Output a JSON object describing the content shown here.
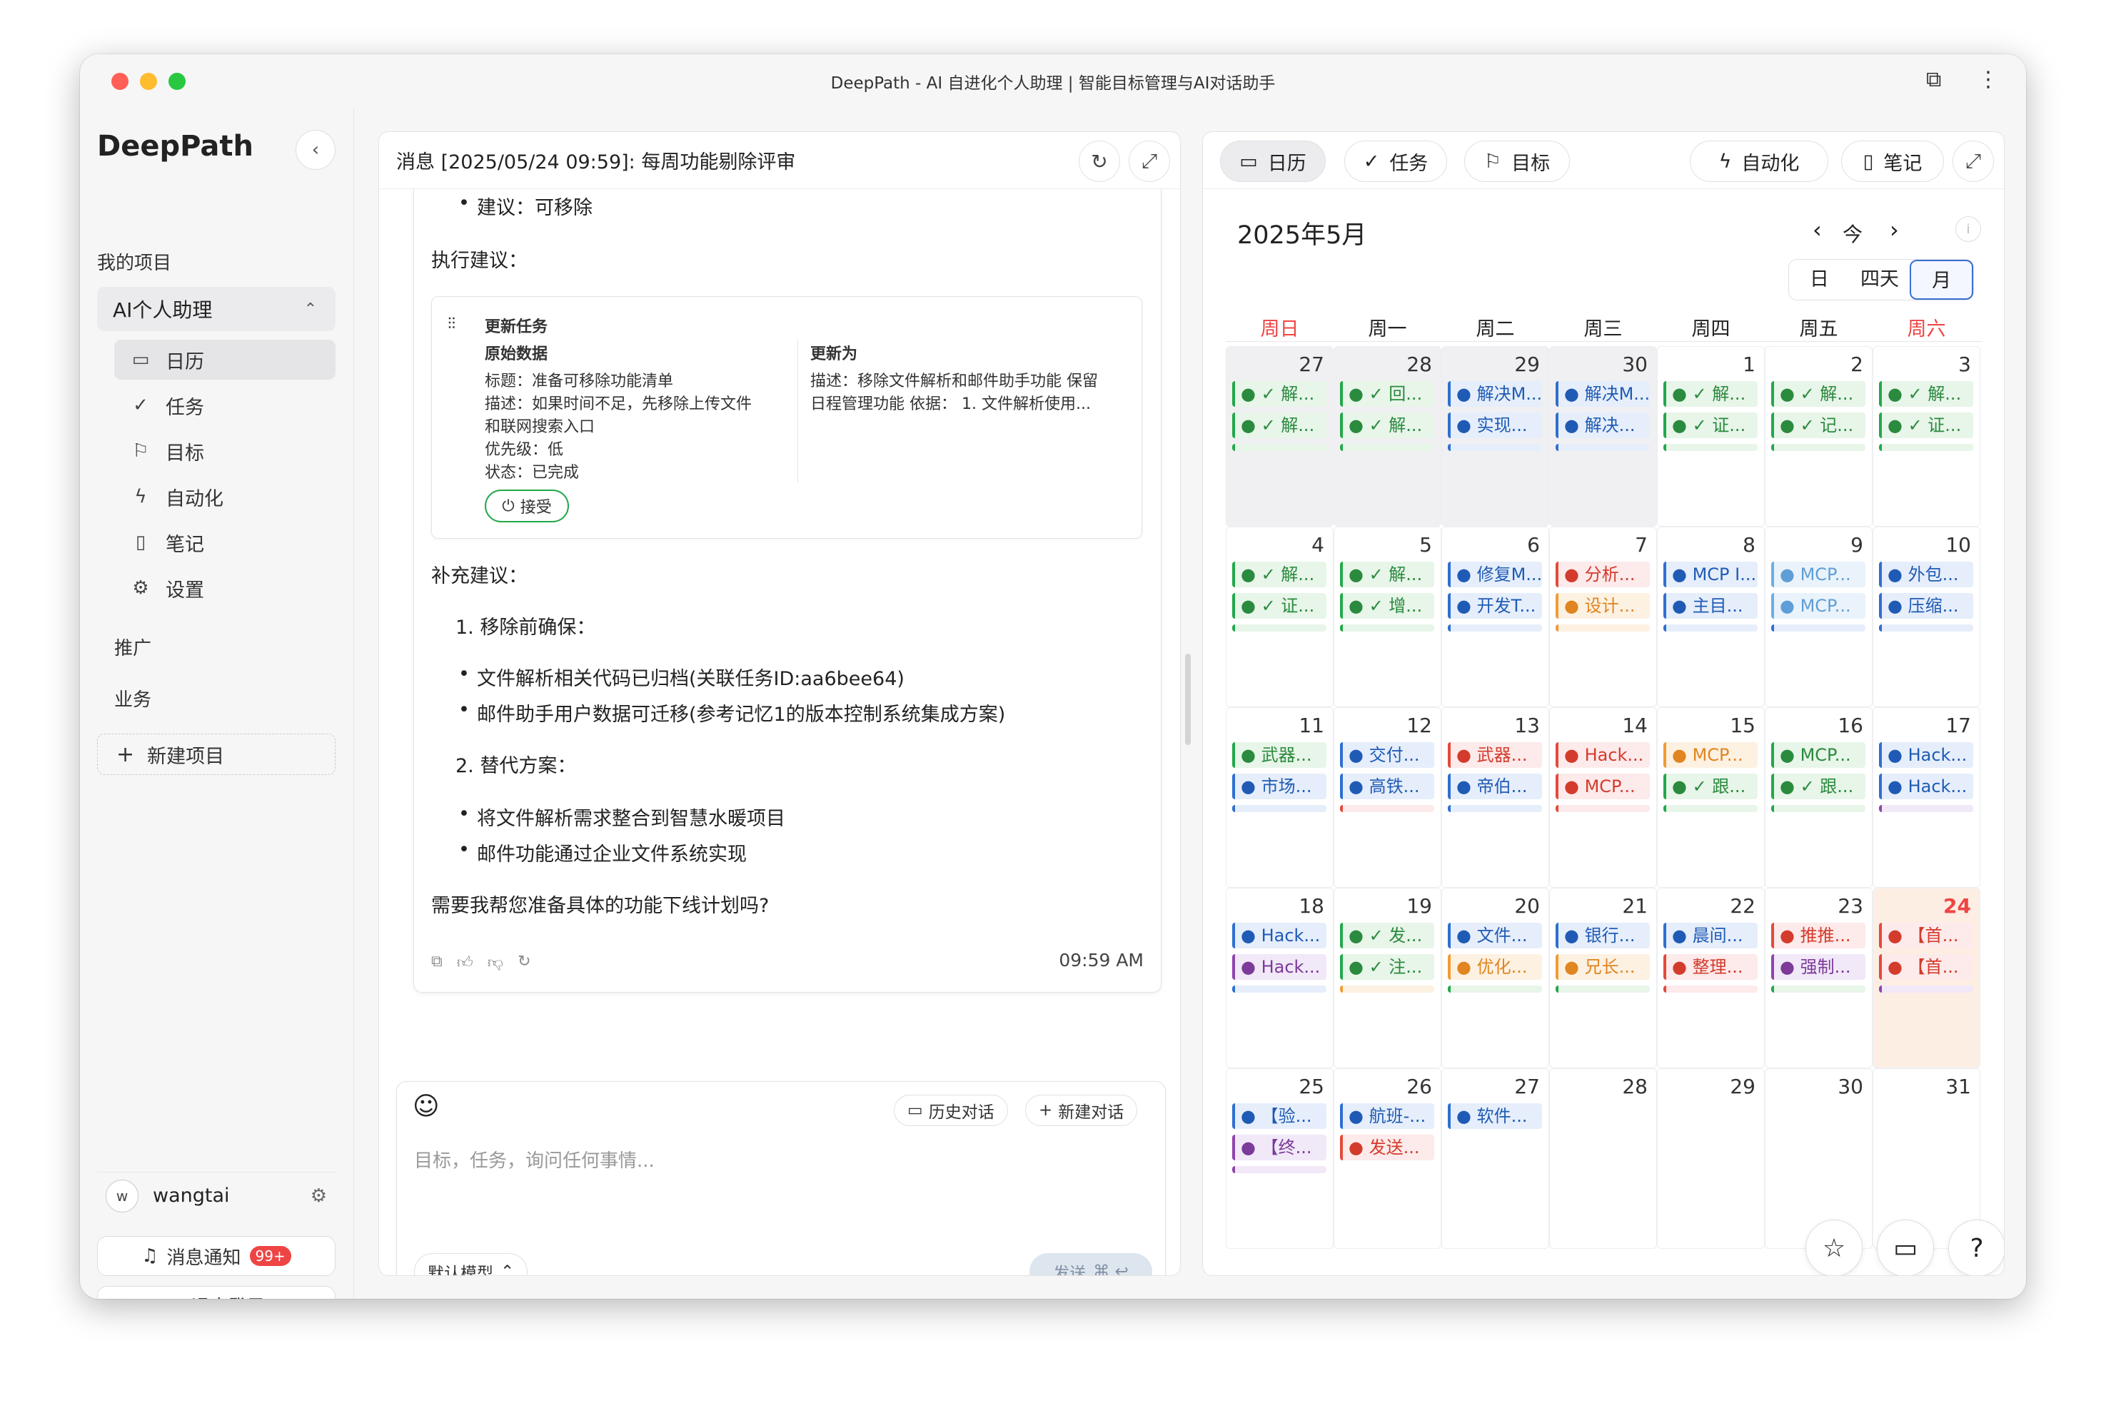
{
  "window": {
    "title": "DeepPath - AI 自进化个人助理 | 智能目标管理与AI对话助手"
  },
  "sidebar": {
    "logo": "DeepPath",
    "my_projects": "我的项目",
    "project": "AI个人助理",
    "items": [
      {
        "icon": "calendar-icon",
        "glyph": "▭",
        "label": "日历",
        "active": true
      },
      {
        "icon": "check-icon",
        "glyph": "✓",
        "label": "任务"
      },
      {
        "icon": "flag-icon",
        "glyph": "⚐",
        "label": "目标"
      },
      {
        "icon": "lightning-icon",
        "glyph": "ϟ",
        "label": "自动化"
      },
      {
        "icon": "book-icon",
        "glyph": "▯",
        "label": "笔记"
      },
      {
        "icon": "gear-icon",
        "glyph": "⚙",
        "label": "设置"
      }
    ],
    "promo": "推广",
    "business": "业务",
    "new_project": "新建项目",
    "user": {
      "initial": "w",
      "name": "wangtai"
    },
    "notifications": "消息通知",
    "notif_badge": "99+",
    "logout": "退出登录"
  },
  "chat": {
    "header": "消息 [2025/05/24 09:59]: 每周功能剔除评审",
    "lines": {
      "l0": "建议：可移除",
      "l1": "执行建议：",
      "s2": "补充建议：",
      "s3": "1. 移除前确保：",
      "b1": "文件解析相关代码已归档(关联任务ID:aa6bee64)",
      "b2": "邮件助手用户数据可迁移(参考记忆1的版本控制系统集成方案)",
      "s4": "2. 替代方案：",
      "b3": "将文件解析需求整合到智慧水暖项目",
      "b4": "邮件功能通过企业文件系统实现",
      "s5": "需要我帮您准备具体的功能下线计划吗?"
    },
    "task_card": {
      "title": "更新任务",
      "orig_label": "原始数据",
      "orig_1": "标题：准备可移除功能清单",
      "orig_2": "描述：如果时间不足，先移除上传文件",
      "orig_3": "和联网搜索入口",
      "orig_4": "优先级：低",
      "orig_5": "状态：已完成",
      "new_label": "更新为",
      "new_1": "描述：移除文件解析和邮件助手功能 保留",
      "new_2": "日程管理功能 依据： 1. 文件解析使用...",
      "accept": "接受"
    },
    "time": "09:59 AM",
    "input": {
      "history": "历史对话",
      "new_chat": "新建对话",
      "placeholder": "目标，任务，询问任何事情...",
      "model": "默认模型",
      "send": "发送",
      "send_keys": "⌘ ↩"
    }
  },
  "calendar": {
    "tabs": [
      {
        "icon": "calendar-icon",
        "glyph": "▭",
        "label": "日历"
      },
      {
        "icon": "check-icon",
        "glyph": "✓",
        "label": "任务"
      },
      {
        "icon": "flag-icon",
        "glyph": "⚐",
        "label": "目标"
      },
      {
        "icon": "lightning-icon",
        "glyph": "ϟ",
        "label": "自动化"
      },
      {
        "icon": "book-icon",
        "glyph": "▯",
        "label": "笔记"
      }
    ],
    "month_title": "2025年5月",
    "today_btn": "今",
    "views": [
      "日",
      "四天",
      "月"
    ],
    "active_view": "月",
    "weekdays": [
      "周日",
      "周一",
      "周二",
      "周三",
      "周四",
      "周五",
      "周六"
    ],
    "weekend_color": "#ef4444",
    "days": [
      {
        "d": "27",
        "other": true,
        "ev": [
          [
            "g",
            "● ✓ 解..."
          ],
          [
            "g",
            "● ✓ 解..."
          ],
          [
            "g",
            "cut"
          ]
        ]
      },
      {
        "d": "28",
        "other": true,
        "ev": [
          [
            "g",
            "● ✓ 回..."
          ],
          [
            "g",
            "● ✓ 解..."
          ],
          [
            "g",
            "cut"
          ]
        ]
      },
      {
        "d": "29",
        "other": true,
        "ev": [
          [
            "b",
            "● 解决M..."
          ],
          [
            "b",
            "● 实现..."
          ],
          [
            "b",
            "cut"
          ]
        ]
      },
      {
        "d": "30",
        "other": true,
        "ev": [
          [
            "b",
            "● 解决M..."
          ],
          [
            "b",
            "● 解决..."
          ],
          [
            "b",
            "cut"
          ]
        ]
      },
      {
        "d": "1",
        "ev": [
          [
            "g",
            "● ✓ 解..."
          ],
          [
            "g",
            "● ✓ 证..."
          ],
          [
            "g",
            "cut"
          ]
        ]
      },
      {
        "d": "2",
        "ev": [
          [
            "g",
            "● ✓ 解..."
          ],
          [
            "g",
            "● ✓ 记..."
          ],
          [
            "g",
            "cut"
          ]
        ]
      },
      {
        "d": "3",
        "ev": [
          [
            "g",
            "● ✓ 解..."
          ],
          [
            "g",
            "● ✓ 证..."
          ],
          [
            "g",
            "cut"
          ]
        ]
      },
      {
        "d": "4",
        "ev": [
          [
            "g",
            "● ✓ 解..."
          ],
          [
            "g",
            "● ✓ 证..."
          ],
          [
            "g",
            "cut"
          ]
        ]
      },
      {
        "d": "5",
        "ev": [
          [
            "g",
            "● ✓ 解..."
          ],
          [
            "g",
            "● ✓ 增..."
          ],
          [
            "g",
            "cut"
          ]
        ]
      },
      {
        "d": "6",
        "ev": [
          [
            "b",
            "● 修复M..."
          ],
          [
            "b",
            "● 开发T..."
          ],
          [
            "b",
            "cut"
          ]
        ]
      },
      {
        "d": "7",
        "ev": [
          [
            "r",
            "● 分析..."
          ],
          [
            "o",
            "● 设计..."
          ],
          [
            "o",
            "cut"
          ]
        ]
      },
      {
        "d": "8",
        "ev": [
          [
            "b",
            "● MCP I..."
          ],
          [
            "b",
            "● 主目..."
          ],
          [
            "b",
            "cut"
          ]
        ]
      },
      {
        "d": "9",
        "ev": [
          [
            "l",
            "● MCP..."
          ],
          [
            "l",
            "● MCP..."
          ],
          [
            "b",
            "cut"
          ]
        ]
      },
      {
        "d": "10",
        "ev": [
          [
            "b",
            "● 外包..."
          ],
          [
            "b",
            "● 压缩..."
          ],
          [
            "b",
            "cut"
          ]
        ]
      },
      {
        "d": "11",
        "ev": [
          [
            "g",
            "● 武器..."
          ],
          [
            "b",
            "● 市场..."
          ],
          [
            "b",
            "cut"
          ]
        ]
      },
      {
        "d": "12",
        "ev": [
          [
            "b",
            "● 交付..."
          ],
          [
            "b",
            "● 高铁..."
          ],
          [
            "r",
            "cut"
          ]
        ]
      },
      {
        "d": "13",
        "ev": [
          [
            "r",
            "● 武器..."
          ],
          [
            "b",
            "● 帝伯..."
          ],
          [
            "b",
            "cut"
          ]
        ]
      },
      {
        "d": "14",
        "ev": [
          [
            "r",
            "● Hack..."
          ],
          [
            "r",
            "● MCP..."
          ],
          [
            "r",
            "cut"
          ]
        ]
      },
      {
        "d": "15",
        "ev": [
          [
            "o",
            "● MCP..."
          ],
          [
            "g",
            "● ✓ 跟..."
          ],
          [
            "g",
            "cut"
          ]
        ]
      },
      {
        "d": "16",
        "ev": [
          [
            "g",
            "● MCP..."
          ],
          [
            "g",
            "● ✓ 跟..."
          ],
          [
            "g",
            "cut"
          ]
        ]
      },
      {
        "d": "17",
        "ev": [
          [
            "b",
            "● Hack..."
          ],
          [
            "b",
            "● Hack..."
          ],
          [
            "p",
            "cut"
          ]
        ]
      },
      {
        "d": "18",
        "ev": [
          [
            "b",
            "● Hack..."
          ],
          [
            "p",
            "● Hack..."
          ],
          [
            "b",
            "cut"
          ]
        ]
      },
      {
        "d": "19",
        "ev": [
          [
            "g",
            "● ✓ 发..."
          ],
          [
            "g",
            "● ✓ 注..."
          ],
          [
            "o",
            "cut"
          ]
        ]
      },
      {
        "d": "20",
        "ev": [
          [
            "b",
            "● 文件..."
          ],
          [
            "o",
            "● 优化..."
          ],
          [
            "g",
            "cut"
          ]
        ]
      },
      {
        "d": "21",
        "ev": [
          [
            "b",
            "● 银行..."
          ],
          [
            "o",
            "● 兄长..."
          ],
          [
            "g",
            "cut"
          ]
        ]
      },
      {
        "d": "22",
        "ev": [
          [
            "b",
            "● 晨间..."
          ],
          [
            "r",
            "● 整理..."
          ],
          [
            "r",
            "cut"
          ]
        ]
      },
      {
        "d": "23",
        "ev": [
          [
            "r",
            "● 推推..."
          ],
          [
            "p",
            "● 强制..."
          ],
          [
            "g",
            "cut"
          ]
        ]
      },
      {
        "d": "24",
        "today": true,
        "ev": [
          [
            "r",
            "● 【首..."
          ],
          [
            "r",
            "● 【首..."
          ],
          [
            "p",
            "cut"
          ]
        ]
      },
      {
        "d": "25",
        "ev": [
          [
            "b",
            "● 【验..."
          ],
          [
            "p",
            "● 【终..."
          ],
          [
            "p",
            "cut"
          ]
        ]
      },
      {
        "d": "26",
        "ev": [
          [
            "b",
            "● 航班-..."
          ],
          [
            "r",
            "● 发送..."
          ]
        ]
      },
      {
        "d": "27",
        "ev": [
          [
            "b",
            "● 软件..."
          ]
        ]
      },
      {
        "d": "28",
        "ev": []
      },
      {
        "d": "29",
        "ev": []
      },
      {
        "d": "30",
        "ev": []
      },
      {
        "d": "31",
        "ev": []
      }
    ]
  }
}
